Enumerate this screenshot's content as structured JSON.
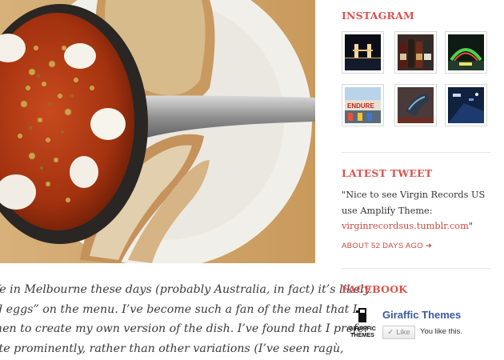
{
  "hero": {
    "alt": "shakshuka in a cast-iron pan with toasted bread"
  },
  "article": {
    "lines": [
      "fe in Melbourne these days (probably Australia, in fact) it’s likely",
      "d eggs” on the menu. I’ve become such a fan of the meal that I",
      "hen to create my own version of the dish. I’ve found that I prefer",
      "ite prominently, rather than other variations (I’ve seen ragù,"
    ]
  },
  "sidebar": {
    "instagram": {
      "title": "INSTAGRAM",
      "thumbs": [
        "tower-bridge-night",
        "beer-bottles",
        "neon-dome",
        "carnival-sign",
        "shoes",
        "night-street"
      ]
    },
    "latest_tweet": {
      "title": "LATEST TWEET",
      "text_before": "\"Nice to see Virgin Records US use Amplify Theme: ",
      "link": "virginrecordsus.tumblr.com",
      "text_after": "\"",
      "meta": "ABOUT 52 DAYS AGO",
      "meta_icon": "arrow-right-icon"
    },
    "facebook": {
      "title": "FACEBOOK",
      "page_name": "Giraffic Themes",
      "logo_text": [
        "GIRAFFIC",
        "THEMES"
      ],
      "like_button_label": "Like",
      "like_text": "You like this."
    }
  },
  "colors": {
    "accent": "#d9534f",
    "facebook_blue": "#3b5998"
  }
}
